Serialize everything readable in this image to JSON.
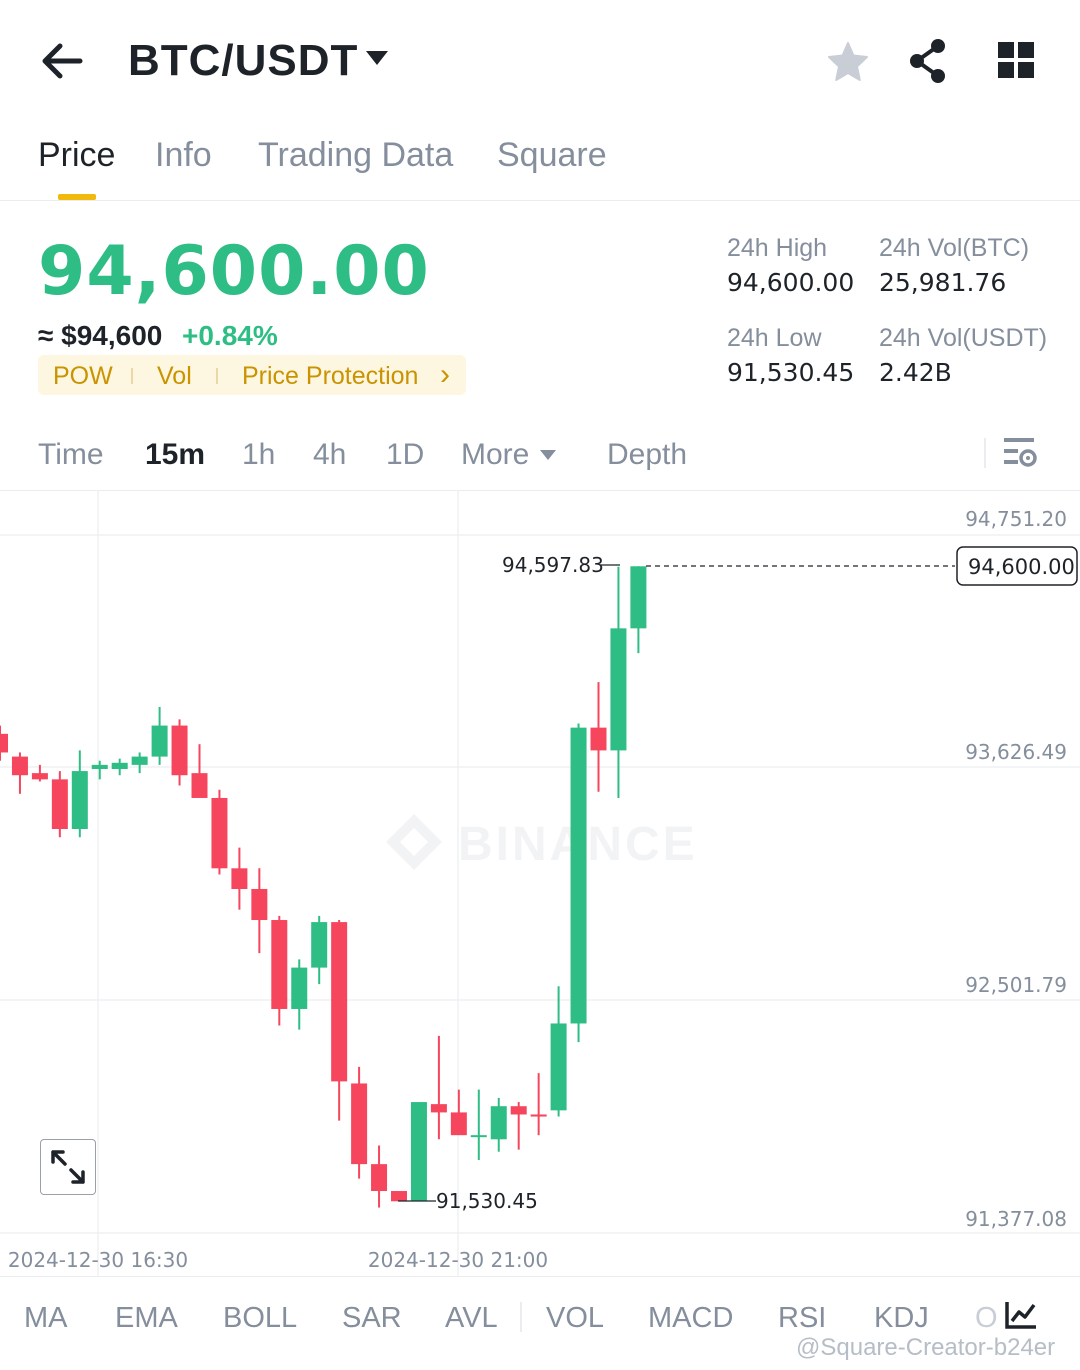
{
  "header": {
    "pair": "BTC/USDT",
    "icons": {
      "back": "arrow-left-icon",
      "dropdown": "caret-down-icon",
      "favorite": "star-icon",
      "share": "share-icon",
      "layout": "grid-icon"
    }
  },
  "tabs": [
    {
      "label": "Price",
      "active": true
    },
    {
      "label": "Info",
      "active": false
    },
    {
      "label": "Trading Data",
      "active": false
    },
    {
      "label": "Square",
      "active": false
    }
  ],
  "ticker": {
    "price": "94,600.00",
    "approx": "≈ $94,600",
    "change": "+0.84%",
    "tags": [
      "POW",
      "Vol",
      "Price Protection"
    ],
    "tag_arrow": "›"
  },
  "stats": {
    "high_label": "24h High",
    "high_value": "94,600.00",
    "low_label": "24h Low",
    "low_value": "91,530.45",
    "vol_btc_label": "24h Vol(BTC)",
    "vol_btc_value": "25,981.76",
    "vol_usdt_label": "24h Vol(USDT)",
    "vol_usdt_value": "2.42B"
  },
  "timeframes": {
    "items": [
      "Time",
      "15m",
      "1h",
      "4h",
      "1D",
      "More",
      "Depth"
    ],
    "active": "15m"
  },
  "chart": {
    "watermark": "BINANCE",
    "price_axis": [
      "94,751.20",
      "93,626.49",
      "92,501.79",
      "91,377.08"
    ],
    "time_axis": [
      "2024-12-30 16:30",
      "2024-12-30 21:00"
    ],
    "current_price_label": "94,600.00",
    "high_marker": "94,597.83",
    "low_marker": "91,530.45"
  },
  "chart_data": {
    "type": "candlestick",
    "y_axis_ticks": [
      94751.2,
      93626.49,
      92501.79,
      91377.08
    ],
    "x_axis_ticks": [
      "2024-12-30 16:30",
      "2024-12-30 21:00"
    ],
    "interval": "15m",
    "candles": [
      {
        "o": 93790,
        "h": 93830,
        "l": 93660,
        "c": 93700
      },
      {
        "o": 93680,
        "h": 93700,
        "l": 93500,
        "c": 93590
      },
      {
        "o": 93600,
        "h": 93640,
        "l": 93560,
        "c": 93570
      },
      {
        "o": 93570,
        "h": 93610,
        "l": 93290,
        "c": 93330
      },
      {
        "o": 93330,
        "h": 93710,
        "l": 93290,
        "c": 93610
      },
      {
        "o": 93620,
        "h": 93660,
        "l": 93570,
        "c": 93640
      },
      {
        "o": 93620,
        "h": 93670,
        "l": 93590,
        "c": 93650
      },
      {
        "o": 93640,
        "h": 93700,
        "l": 93600,
        "c": 93680
      },
      {
        "o": 93680,
        "h": 93920,
        "l": 93640,
        "c": 93830
      },
      {
        "o": 93830,
        "h": 93860,
        "l": 93540,
        "c": 93590
      },
      {
        "o": 93600,
        "h": 93740,
        "l": 93510,
        "c": 93480
      },
      {
        "o": 93480,
        "h": 93520,
        "l": 93110,
        "c": 93140
      },
      {
        "o": 93140,
        "h": 93240,
        "l": 92940,
        "c": 93040
      },
      {
        "o": 93040,
        "h": 93140,
        "l": 92730,
        "c": 92890
      },
      {
        "o": 92890,
        "h": 92910,
        "l": 92380,
        "c": 92460
      },
      {
        "o": 92460,
        "h": 92700,
        "l": 92360,
        "c": 92660
      },
      {
        "o": 92660,
        "h": 92910,
        "l": 92580,
        "c": 92880
      },
      {
        "o": 92880,
        "h": 92890,
        "l": 91920,
        "c": 92110
      },
      {
        "o": 92100,
        "h": 92180,
        "l": 91640,
        "c": 91710
      },
      {
        "o": 91710,
        "h": 91800,
        "l": 91500,
        "c": 91580
      },
      {
        "o": 91580,
        "h": 91580,
        "l": 91530.45,
        "c": 91530.45
      },
      {
        "o": 91530,
        "h": 92010,
        "l": 91600,
        "c": 92010
      },
      {
        "o": 92000,
        "h": 92330,
        "l": 91830,
        "c": 91960
      },
      {
        "o": 91960,
        "h": 92070,
        "l": 91860,
        "c": 91850
      },
      {
        "o": 91850,
        "h": 92070,
        "l": 91730,
        "c": 91850
      },
      {
        "o": 91830,
        "h": 92030,
        "l": 91770,
        "c": 91990
      },
      {
        "o": 91990,
        "h": 92010,
        "l": 91780,
        "c": 91950
      },
      {
        "o": 91950,
        "h": 92150,
        "l": 91850,
        "c": 91940
      },
      {
        "o": 91970,
        "h": 92570,
        "l": 91940,
        "c": 92390
      },
      {
        "o": 92390,
        "h": 93840,
        "l": 92300,
        "c": 93820
      },
      {
        "o": 93820,
        "h": 94040,
        "l": 93510,
        "c": 93710
      },
      {
        "o": 93710,
        "h": 94597.83,
        "l": 93480,
        "c": 94300
      },
      {
        "o": 94300,
        "h": 94600,
        "l": 94180,
        "c": 94600
      }
    ]
  },
  "indicators": [
    "MA",
    "EMA",
    "BOLL",
    "SAR",
    "AVL",
    "VOL",
    "MACD",
    "RSI",
    "KDJ",
    "O"
  ],
  "footer": {
    "watermark": "@Square-Creator-b24er"
  },
  "colors": {
    "up": "#2ebd85",
    "down": "#f6465d",
    "accent": "#f0b90b",
    "muted": "#848e9c"
  }
}
